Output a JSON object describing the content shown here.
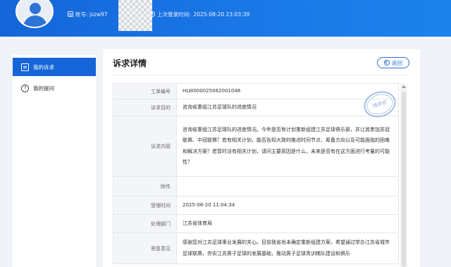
{
  "header": {
    "account_label": "账号: jszw97",
    "last_login_label": "上次登录时间:",
    "last_login_time": "2025-08-20 23:03:39"
  },
  "sidebar": {
    "items": [
      {
        "label": "我的诉求",
        "icon": "message-icon",
        "active": true
      },
      {
        "label": "我的提问",
        "icon": "question-icon",
        "active": false
      }
    ]
  },
  "main": {
    "title": "诉求详情",
    "back_label": "返回",
    "stamp_label": "待评价",
    "rows": [
      {
        "label": "工单编号",
        "value": "HLW000025082001048"
      },
      {
        "label": "诉求目的",
        "value": "咨询省重组江苏足球队的进度情况"
      },
      {
        "label": "诉求内容",
        "value": "咨询省重组江苏足球队的进度情况。今年是否有计划重新组建江苏足球俱乐部，并让其参加苏冠联赛、中冠联赛？若有相关计划，能否告知大致的推进时间节点、筹备方向以及可能面临的困难和解决方案？若暂时没有相关计划，请问主要原因是什么，未来是否有在这方面进行考量的可能性？"
      },
      {
        "label": "附件",
        "value": ""
      },
      {
        "label": "受理时间",
        "value": "2025-08-20 11:04:34"
      },
      {
        "label": "处理部门",
        "value": "江苏省体育局"
      },
      {
        "label": "答复意见",
        "value": "感谢您对江苏足球事业发展的关心。目前我省尚未确定重新组建方案，希望通过举办江苏省城市足球联赛，夯实江苏男子足球的发展基础，推动男子足球青训梯队建设和俱乐"
      }
    ]
  }
}
